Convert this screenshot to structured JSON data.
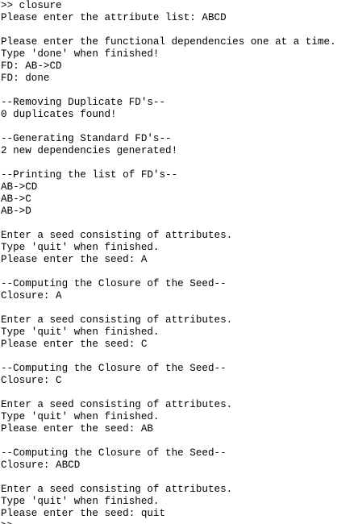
{
  "terminal": {
    "lines": [
      ">> closure",
      "Please enter the attribute list: ABCD",
      "",
      "Please enter the functional dependencies one at a time.",
      "Type 'done' when finished!",
      "FD: AB->CD",
      "FD: done",
      "",
      "--Removing Duplicate FD's--",
      "0 duplicates found!",
      "",
      "--Generating Standard FD's--",
      "2 new dependencies generated!",
      "",
      "--Printing the list of FD's--",
      "AB->CD",
      "AB->C",
      "AB->D",
      "",
      "Enter a seed consisting of attributes.",
      "Type 'quit' when finished.",
      "Please enter the seed: A",
      "",
      "--Computing the Closure of the Seed--",
      "Closure: A",
      "",
      "Enter a seed consisting of attributes.",
      "Type 'quit' when finished.",
      "Please enter the seed: C",
      "",
      "--Computing the Closure of the Seed--",
      "Closure: C",
      "",
      "Enter a seed consisting of attributes.",
      "Type 'quit' when finished.",
      "Please enter the seed: AB",
      "",
      "--Computing the Closure of the Seed--",
      "Closure: ABCD",
      "",
      "Enter a seed consisting of attributes.",
      "Type 'quit' when finished.",
      "Please enter the seed: quit",
      ">> "
    ]
  }
}
